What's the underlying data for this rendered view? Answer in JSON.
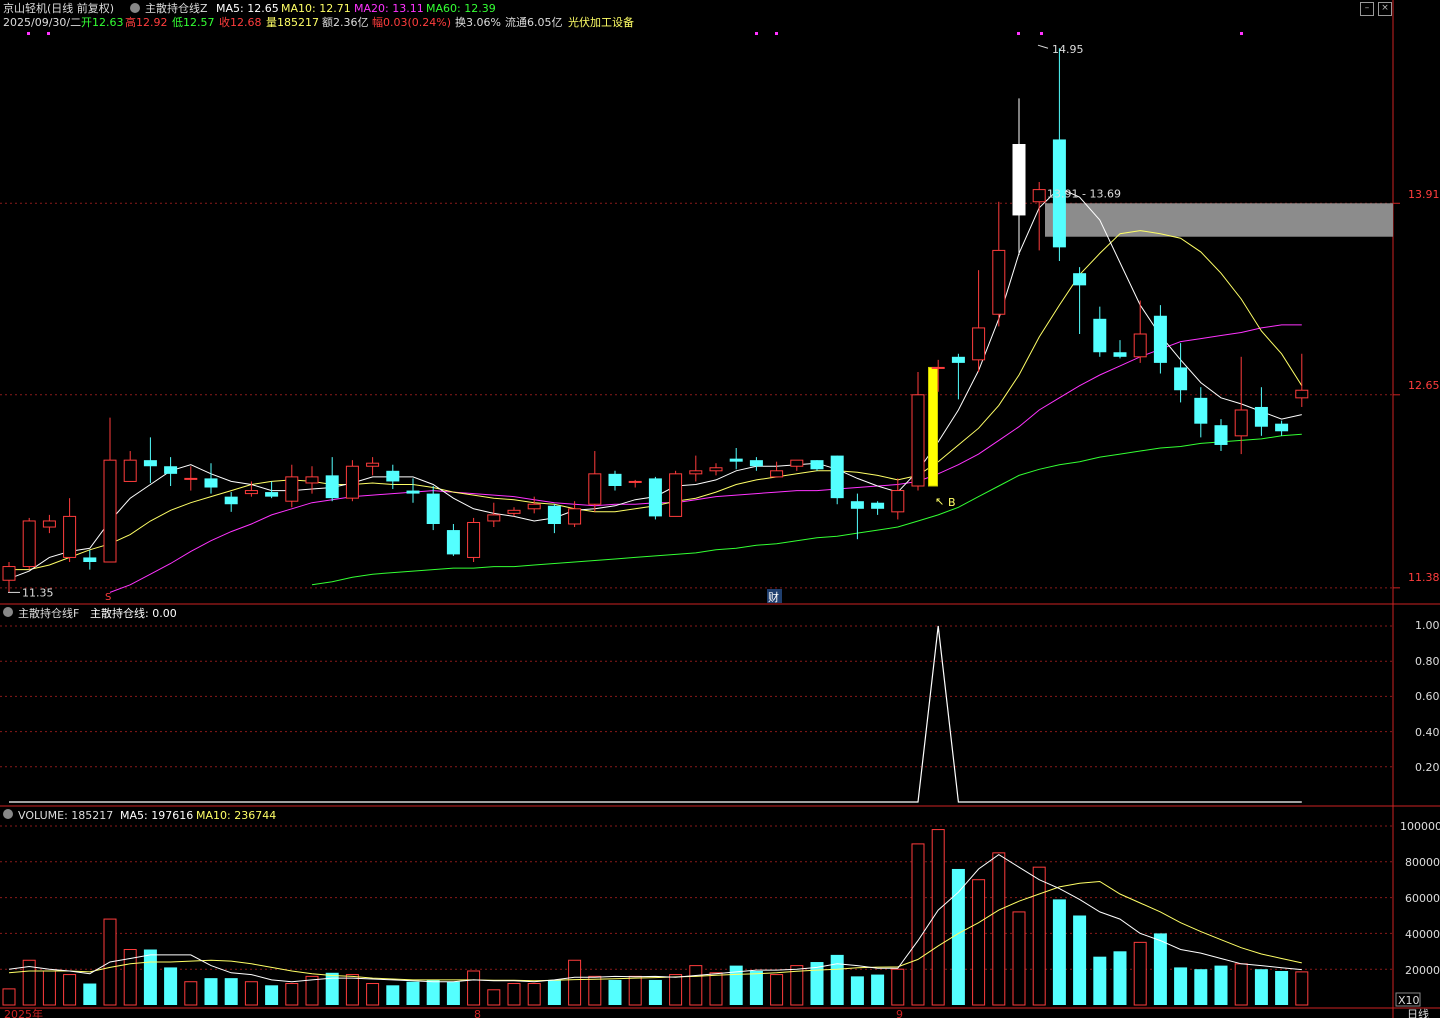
{
  "header": {
    "title": "京山轻机(日线 前复权)",
    "indicator_name": "主散持仓线Z",
    "ma5": "MA5: 12.65",
    "ma10": "MA10: 12.71",
    "ma20": "MA20: 13.11",
    "ma60": "MA60: 12.39",
    "date": "2025/09/30/二",
    "open": "开12.63",
    "high": "高12.92",
    "low": "低12.57",
    "close": "收12.68",
    "volume": "量185217",
    "amount": "额2.36亿",
    "amplitude": "幅0.03(0.24%)",
    "turnover": "换3.06%",
    "float": "流通6.05亿",
    "sector": "光伏加工设备"
  },
  "colors": {
    "up": "#ff3d3d",
    "down": "#54ffff",
    "ma5": "#ffffff",
    "ma10": "#ffff66",
    "ma20": "#ff33ff",
    "ma60": "#33ff33",
    "grid": "#8a1a1a",
    "axis": "#cc2222"
  },
  "price_axis": [
    "13.91",
    "12.65",
    "11.38"
  ],
  "annotations": {
    "high_label": "14.95",
    "low_label": "11.35",
    "zone_label": "13.91 - 13.69",
    "buy_label": "B",
    "finance_label": "财"
  },
  "indicator_panel": {
    "title": "主散持仓线F",
    "value": "主散持仓线: 0.00",
    "axis": [
      "1.00",
      "0.80",
      "0.60",
      "0.40",
      "0.20"
    ]
  },
  "volume_panel": {
    "volume": "VOLUME: 185217",
    "ma5": "MA5: 197616",
    "ma10": "MA10: 236744",
    "axis": [
      "100000",
      "80000",
      "60000",
      "40000",
      "20000"
    ],
    "unit": "X10"
  },
  "time_axis": {
    "year": "2025年",
    "m8": "8",
    "m9": "9",
    "period": "日线"
  },
  "chart_data": {
    "type": "candlestick",
    "ylim": [
      11.3,
      15.05
    ],
    "candles": [
      [
        11.43,
        11.52,
        11.35,
        11.55
      ],
      [
        11.52,
        11.82,
        11.5,
        11.84
      ],
      [
        11.78,
        11.82,
        11.74,
        11.86
      ],
      [
        11.58,
        11.85,
        11.55,
        11.97
      ],
      [
        11.58,
        11.55,
        11.5,
        11.63
      ],
      [
        11.55,
        12.22,
        11.55,
        12.5
      ],
      [
        12.08,
        12.22,
        12.08,
        12.28
      ],
      [
        12.22,
        12.18,
        12.07,
        12.37
      ],
      [
        12.18,
        12.13,
        12.05,
        12.24
      ],
      [
        12.1,
        12.1,
        12.02,
        12.18
      ],
      [
        12.1,
        12.04,
        12.0,
        12.2
      ],
      [
        11.98,
        11.93,
        11.88,
        12.01
      ],
      [
        12.0,
        12.02,
        11.98,
        12.08
      ],
      [
        12.01,
        11.98,
        11.97,
        12.08
      ],
      [
        11.95,
        12.11,
        11.91,
        12.19
      ],
      [
        12.07,
        12.11,
        12.0,
        12.18
      ],
      [
        12.12,
        11.97,
        11.95,
        12.24
      ],
      [
        11.97,
        12.18,
        11.95,
        12.22
      ],
      [
        12.18,
        12.2,
        12.12,
        12.24
      ],
      [
        12.15,
        12.08,
        12.03,
        12.19
      ],
      [
        12.02,
        12.0,
        11.94,
        12.1
      ],
      [
        12.0,
        11.8,
        11.76,
        12.05
      ],
      [
        11.76,
        11.6,
        11.59,
        11.8
      ],
      [
        11.58,
        11.81,
        11.55,
        11.84
      ],
      [
        11.82,
        11.86,
        11.78,
        11.94
      ],
      [
        11.87,
        11.89,
        11.85,
        11.91
      ],
      [
        11.9,
        11.93,
        11.87,
        11.98
      ],
      [
        11.92,
        11.8,
        11.74,
        11.93
      ],
      [
        11.8,
        11.9,
        11.78,
        11.95
      ],
      [
        11.93,
        12.13,
        11.88,
        12.28
      ],
      [
        12.13,
        12.05,
        12.02,
        12.15
      ],
      [
        12.08,
        12.08,
        12.04,
        12.09
      ],
      [
        12.1,
        11.85,
        11.83,
        12.11
      ],
      [
        11.85,
        12.13,
        11.85,
        12.15
      ],
      [
        12.13,
        12.15,
        12.08,
        12.25
      ],
      [
        12.15,
        12.17,
        12.12,
        12.2
      ],
      [
        12.23,
        12.21,
        12.16,
        12.3
      ],
      [
        12.22,
        12.18,
        12.15,
        12.24
      ],
      [
        12.11,
        12.15,
        12.13,
        12.21
      ],
      [
        12.18,
        12.22,
        12.15,
        12.21
      ],
      [
        12.22,
        12.16,
        12.15,
        12.22
      ],
      [
        12.25,
        11.97,
        11.93,
        12.25
      ],
      [
        11.95,
        11.9,
        11.7,
        12.0
      ],
      [
        11.94,
        11.9,
        11.86,
        11.95
      ],
      [
        11.88,
        12.02,
        11.83,
        12.1
      ],
      [
        12.05,
        12.65,
        12.02,
        12.8
      ],
      [
        12.83,
        12.83,
        12.67,
        12.88
      ],
      [
        12.9,
        12.86,
        12.62,
        12.92
      ],
      [
        12.88,
        13.09,
        12.8,
        13.47
      ],
      [
        13.18,
        13.6,
        13.1,
        13.92
      ],
      [
        13.83,
        14.3,
        13.57,
        14.6
      ],
      [
        13.92,
        14.0,
        13.6,
        14.05
      ],
      [
        14.33,
        13.62,
        13.53,
        14.93
      ],
      [
        13.45,
        13.37,
        13.05,
        13.49
      ],
      [
        13.15,
        12.93,
        12.9,
        13.23
      ],
      [
        12.93,
        12.9,
        12.89,
        13.01
      ],
      [
        12.9,
        13.05,
        12.86,
        13.27
      ],
      [
        13.17,
        12.86,
        12.79,
        13.24
      ],
      [
        12.83,
        12.68,
        12.6,
        12.99
      ],
      [
        12.63,
        12.46,
        12.37,
        12.7
      ],
      [
        12.45,
        12.32,
        12.28,
        12.49
      ],
      [
        12.38,
        12.55,
        12.26,
        12.9
      ],
      [
        12.57,
        12.44,
        12.38,
        12.7
      ],
      [
        12.46,
        12.41,
        12.38,
        12.48
      ],
      [
        12.63,
        12.68,
        12.57,
        12.92
      ]
    ],
    "hollow_index": 50,
    "signal_bar_index": 45,
    "ma5": [
      11.44,
      11.49,
      11.58,
      11.62,
      11.64,
      11.82,
      11.97,
      12.06,
      12.15,
      12.19,
      12.13,
      12.08,
      12.06,
      12.02,
      12.02,
      12.03,
      12.04,
      12.07,
      12.11,
      12.11,
      12.11,
      12.06,
      11.97,
      11.9,
      11.87,
      11.85,
      11.82,
      11.84,
      11.89,
      11.9,
      11.92,
      11.96,
      11.98,
      12.05,
      12.06,
      12.09,
      12.15,
      12.18,
      12.18,
      12.19,
      12.2,
      12.16,
      12.1,
      12.05,
      12.01,
      12.15,
      12.34,
      12.55,
      12.81,
      13.15,
      13.58,
      13.88,
      14.01,
      13.95,
      13.8,
      13.52,
      13.24,
      13.04,
      12.88,
      12.73,
      12.63,
      12.59,
      12.54,
      12.49,
      12.52
    ],
    "ma10": [
      11.5,
      11.5,
      11.53,
      11.58,
      11.63,
      11.67,
      11.73,
      11.82,
      11.89,
      11.94,
      11.98,
      12.02,
      12.06,
      12.08,
      12.09,
      12.08,
      12.06,
      12.06,
      12.07,
      12.06,
      12.06,
      12.04,
      12.01,
      11.99,
      11.97,
      11.96,
      11.94,
      11.93,
      11.9,
      11.88,
      11.88,
      11.9,
      11.92,
      11.95,
      11.97,
      12.01,
      12.06,
      12.09,
      12.11,
      12.13,
      12.15,
      12.15,
      12.14,
      12.12,
      12.09,
      12.12,
      12.21,
      12.32,
      12.43,
      12.58,
      12.78,
      13.03,
      13.24,
      13.44,
      13.58,
      13.71,
      13.73,
      13.71,
      13.68,
      13.59,
      13.45,
      13.28,
      13.07,
      12.92,
      12.71
    ],
    "ma20": [
      null,
      null,
      null,
      null,
      null,
      11.35,
      11.4,
      11.47,
      11.54,
      11.62,
      11.69,
      11.75,
      11.8,
      11.86,
      11.9,
      11.94,
      11.96,
      11.98,
      11.99,
      12.0,
      12.01,
      12.02,
      12.01,
      12.0,
      11.99,
      11.98,
      11.96,
      11.94,
      11.93,
      11.92,
      11.93,
      11.93,
      11.94,
      11.94,
      11.96,
      11.98,
      11.99,
      12.0,
      12.01,
      12.02,
      12.02,
      12.03,
      12.04,
      12.05,
      12.06,
      12.08,
      12.13,
      12.19,
      12.26,
      12.35,
      12.44,
      12.55,
      12.63,
      12.71,
      12.78,
      12.84,
      12.9,
      12.95,
      13.0,
      13.02,
      13.04,
      13.06,
      13.09,
      13.11,
      13.11
    ],
    "ma60": [
      null,
      null,
      null,
      null,
      null,
      null,
      null,
      null,
      null,
      null,
      null,
      null,
      null,
      null,
      null,
      11.4,
      11.42,
      11.45,
      11.47,
      11.48,
      11.49,
      11.5,
      11.51,
      11.51,
      11.52,
      11.52,
      11.53,
      11.54,
      11.55,
      11.56,
      11.57,
      11.58,
      11.59,
      11.6,
      11.61,
      11.63,
      11.64,
      11.66,
      11.67,
      11.69,
      11.71,
      11.72,
      11.74,
      11.76,
      11.78,
      11.82,
      11.86,
      11.91,
      11.98,
      12.05,
      12.12,
      12.16,
      12.19,
      12.21,
      12.24,
      12.26,
      12.28,
      12.3,
      12.31,
      12.33,
      12.34,
      12.35,
      12.36,
      12.38,
      12.39
    ],
    "indicator": [
      0,
      0,
      0,
      0,
      0,
      0,
      0,
      0,
      0,
      0,
      0,
      0,
      0,
      0,
      0,
      0,
      0,
      0,
      0,
      0,
      0,
      0,
      0,
      0,
      0,
      0,
      0,
      0,
      0,
      0,
      0,
      0,
      0,
      0,
      0,
      0,
      0,
      0,
      0,
      0,
      0,
      0,
      0,
      0,
      0,
      0,
      1,
      0,
      0,
      0,
      0,
      0,
      0,
      0,
      0,
      0,
      0,
      0,
      0,
      0,
      0,
      0,
      0,
      0,
      0
    ],
    "volume": [
      9000,
      25000,
      19000,
      17000,
      12000,
      48000,
      31000,
      31000,
      21000,
      13000,
      15000,
      15000,
      13000,
      11000,
      12000,
      16000,
      18000,
      17000,
      12000,
      11000,
      13000,
      14000,
      13000,
      19000,
      8500,
      12000,
      12000,
      14000,
      25000,
      16000,
      14000,
      16000,
      14000,
      17000,
      22000,
      18000,
      22000,
      19000,
      17000,
      22000,
      24000,
      28000,
      16000,
      17000,
      20000,
      90000,
      98000,
      76000,
      70000,
      85000,
      52000,
      77000,
      59000,
      50000,
      27000,
      30000,
      35000,
      40000,
      21000,
      20000,
      22000,
      23000,
      20000,
      19000,
      18500
    ],
    "vol_ma5": [
      20000,
      21500,
      20000,
      19000,
      17500,
      24000,
      26000,
      28000,
      28000,
      28000,
      22000,
      18000,
      17000,
      14000,
      13000,
      14000,
      15000,
      15000,
      14500,
      14000,
      13500,
      13000,
      13000,
      14000,
      13500,
      13500,
      13000,
      14000,
      15500,
      15500,
      16000,
      15800,
      16000,
      15500,
      16500,
      17500,
      18500,
      19500,
      19500,
      20000,
      21000,
      23000,
      22000,
      20500,
      20500,
      36000,
      53000,
      63000,
      76000,
      84000,
      77000,
      70000,
      65000,
      59000,
      52000,
      48000,
      40000,
      36000,
      31000,
      29000,
      26000,
      23000,
      22000,
      20800,
      19800
    ],
    "vol_ma10": [
      18000,
      19000,
      19000,
      19000,
      18500,
      21000,
      23000,
      24000,
      24000,
      24500,
      25000,
      24500,
      23000,
      21000,
      19000,
      17500,
      16500,
      16000,
      15000,
      14500,
      14000,
      14000,
      14000,
      14000,
      13800,
      13800,
      13600,
      13800,
      14200,
      14400,
      14700,
      15000,
      15300,
      15700,
      16000,
      16600,
      17100,
      17500,
      18000,
      18800,
      19500,
      20000,
      20800,
      21200,
      21300,
      25500,
      33000,
      40000,
      46000,
      53000,
      58000,
      62000,
      66000,
      68000,
      69000,
      62000,
      57000,
      52000,
      46000,
      41000,
      36500,
      32000,
      28500,
      26000,
      23500
    ]
  }
}
